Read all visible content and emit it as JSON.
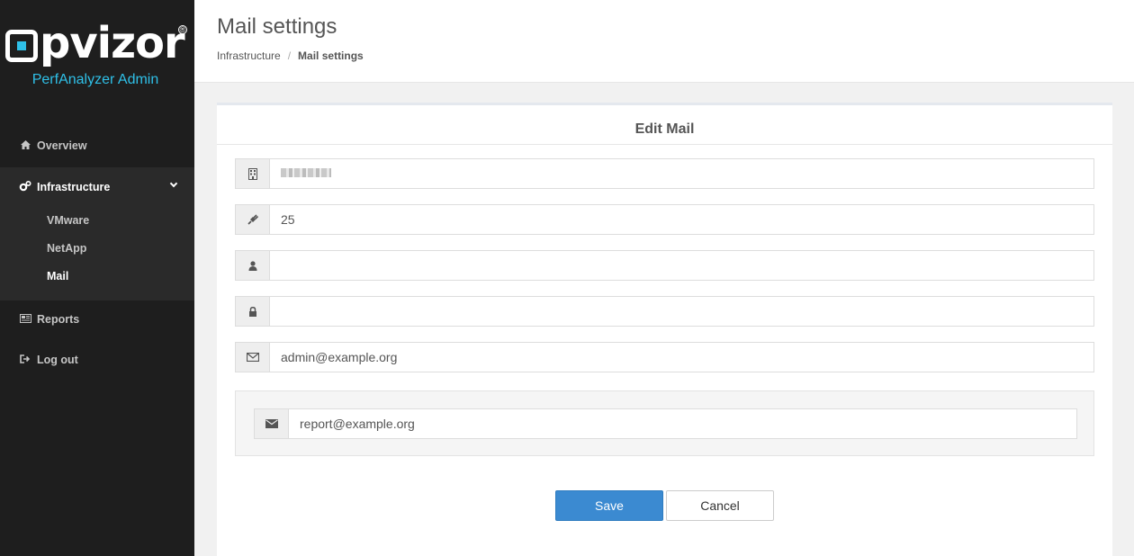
{
  "sidebar": {
    "logo_text": "pvizor",
    "subtitle": "PerfAnalyzer Admin",
    "items": [
      {
        "label": "Overview",
        "icon": "home-icon"
      },
      {
        "label": "Infrastructure",
        "icon": "cogs-icon"
      },
      {
        "label": "Reports",
        "icon": "newspaper-icon"
      },
      {
        "label": "Log out",
        "icon": "sign-out-icon"
      }
    ],
    "subitems": [
      {
        "label": "VMware"
      },
      {
        "label": "NetApp"
      },
      {
        "label": "Mail"
      }
    ]
  },
  "header": {
    "title": "Mail settings",
    "breadcrumb": [
      "Infrastructure",
      "Mail settings"
    ]
  },
  "panel": {
    "title": "Edit Mail",
    "fields": [
      {
        "icon": "building-icon",
        "value": "",
        "placeholder": ""
      },
      {
        "icon": "plug-icon",
        "value": "25",
        "placeholder": ""
      },
      {
        "icon": "user-icon",
        "value": "",
        "placeholder": ""
      },
      {
        "icon": "lock-icon",
        "value": "",
        "placeholder": ""
      },
      {
        "icon": "envelope-outline-icon",
        "value": "admin@example.org",
        "placeholder": ""
      }
    ],
    "recipient": {
      "icon": "envelope-icon",
      "value": "report@example.org"
    },
    "save_label": "Save",
    "cancel_label": "Cancel"
  },
  "colors": {
    "sidebar_bg": "#1e1e1e",
    "accent": "#2fc0e8",
    "primary_button": "#3b8ad1"
  }
}
